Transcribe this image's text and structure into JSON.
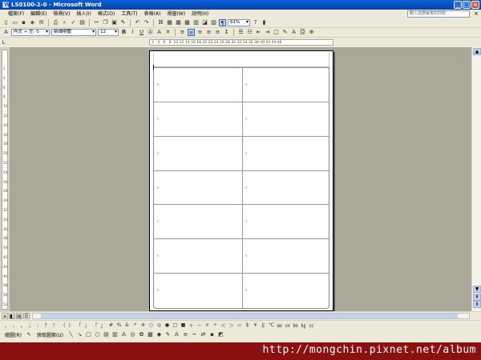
{
  "window": {
    "title": "LS0100-2-0 - Microsoft Word"
  },
  "menu": {
    "items": [
      "檔案(F)",
      "編輯(E)",
      "檢視(V)",
      "插入(I)",
      "格式(O)",
      "工具(T)",
      "表格(A)",
      "視窗(W)",
      "說明(H)"
    ],
    "help_placeholder": "輸入需要解答的問題"
  },
  "toolbar": {
    "zoom": "61%",
    "style": "內文 + 左: 0",
    "font": "新細明體",
    "size": "12",
    "bold": "B",
    "italic": "I",
    "underline": "U"
  },
  "ruler": {
    "numbers": [
      "2",
      "4",
      "6",
      "8",
      "10",
      "12",
      "14",
      "16",
      "18",
      "20",
      "22",
      "24",
      "26",
      "28",
      "30",
      "32",
      "34",
      "36",
      "38",
      "40",
      "42",
      "44",
      "46"
    ]
  },
  "vruler": {
    "numbers": [
      "2",
      "4",
      "6",
      "8",
      "10",
      "12",
      "14",
      "16",
      "18",
      "20",
      "22",
      "24",
      "26",
      "28",
      "30",
      "32",
      "34",
      "36",
      "38",
      "40",
      "42",
      "44",
      "46",
      "48",
      "50",
      "52"
    ]
  },
  "table": {
    "rows": 7,
    "cols": 2
  },
  "drawing": {
    "draw_label": "繪圖(R)",
    "autoshapes_label": "快取圖案(U)"
  },
  "symbols": [
    "，",
    "、",
    "。",
    "；",
    "：",
    "？",
    "！",
    "（",
    "）",
    "「",
    "」",
    "『",
    "』",
    "#",
    "%",
    "&",
    "*",
    "※",
    "○",
    "◎",
    "●",
    "□",
    "■",
    "＋",
    "－",
    "×",
    "÷",
    "＜",
    "＞",
    "＝",
    "$",
    "¥",
    "￡",
    "℃",
    "㎜",
    "㎝",
    "㎞",
    "㎏",
    "㏄"
  ],
  "status": {
    "text": ""
  },
  "watermark": {
    "text": "http://mongchin.pixnet.net/album"
  },
  "colors": {
    "titlebar": "#0842a8",
    "chrome": "#ece9d8",
    "canvas": "#aca899",
    "watermark_bg": "#8b1010"
  }
}
